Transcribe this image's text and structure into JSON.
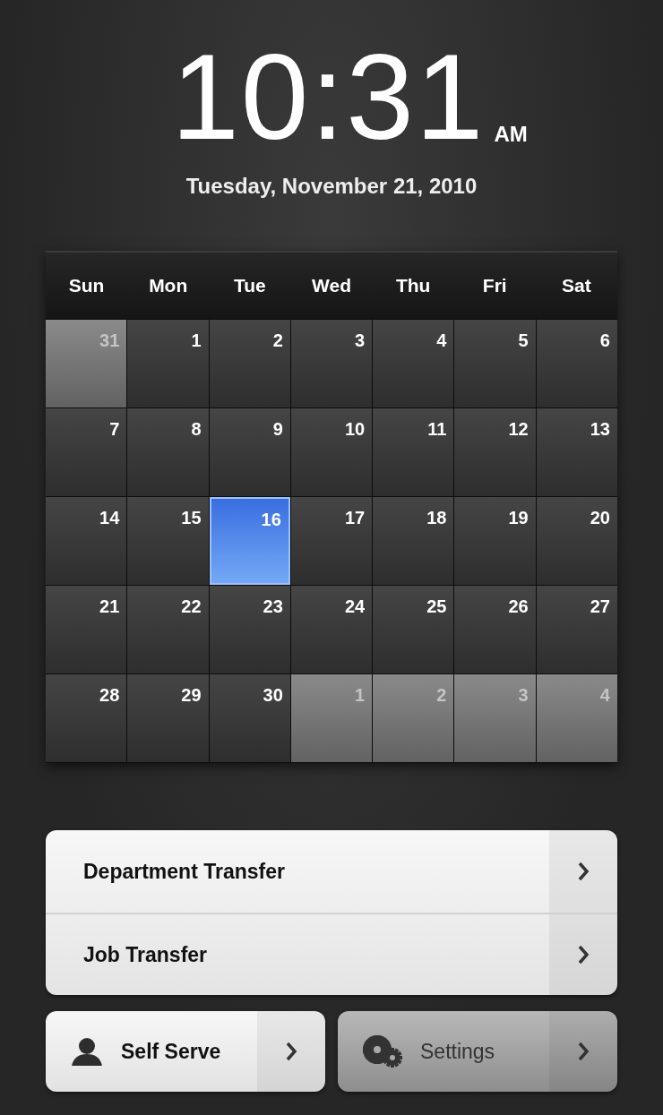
{
  "clock": {
    "time": "10:31",
    "meridiem": "AM",
    "date": "Tuesday, November 21, 2010"
  },
  "calendar": {
    "weekdays": [
      "Sun",
      "Mon",
      "Tue",
      "Wed",
      "Thu",
      "Fri",
      "Sat"
    ],
    "days": [
      {
        "label": "31",
        "muted": true,
        "selected": false
      },
      {
        "label": "1",
        "muted": false,
        "selected": false
      },
      {
        "label": "2",
        "muted": false,
        "selected": false
      },
      {
        "label": "3",
        "muted": false,
        "selected": false
      },
      {
        "label": "4",
        "muted": false,
        "selected": false
      },
      {
        "label": "5",
        "muted": false,
        "selected": false
      },
      {
        "label": "6",
        "muted": false,
        "selected": false
      },
      {
        "label": "7",
        "muted": false,
        "selected": false
      },
      {
        "label": "8",
        "muted": false,
        "selected": false
      },
      {
        "label": "9",
        "muted": false,
        "selected": false
      },
      {
        "label": "10",
        "muted": false,
        "selected": false
      },
      {
        "label": "11",
        "muted": false,
        "selected": false
      },
      {
        "label": "12",
        "muted": false,
        "selected": false
      },
      {
        "label": "13",
        "muted": false,
        "selected": false
      },
      {
        "label": "14",
        "muted": false,
        "selected": false
      },
      {
        "label": "15",
        "muted": false,
        "selected": false
      },
      {
        "label": "16",
        "muted": false,
        "selected": true
      },
      {
        "label": "17",
        "muted": false,
        "selected": false
      },
      {
        "label": "18",
        "muted": false,
        "selected": false
      },
      {
        "label": "19",
        "muted": false,
        "selected": false
      },
      {
        "label": "20",
        "muted": false,
        "selected": false
      },
      {
        "label": "21",
        "muted": false,
        "selected": false
      },
      {
        "label": "22",
        "muted": false,
        "selected": false
      },
      {
        "label": "23",
        "muted": false,
        "selected": false
      },
      {
        "label": "24",
        "muted": false,
        "selected": false
      },
      {
        "label": "25",
        "muted": false,
        "selected": false
      },
      {
        "label": "26",
        "muted": false,
        "selected": false
      },
      {
        "label": "27",
        "muted": false,
        "selected": false
      },
      {
        "label": "28",
        "muted": false,
        "selected": false
      },
      {
        "label": "29",
        "muted": false,
        "selected": false
      },
      {
        "label": "30",
        "muted": false,
        "selected": false
      },
      {
        "label": "1",
        "muted": true,
        "selected": false
      },
      {
        "label": "2",
        "muted": true,
        "selected": false
      },
      {
        "label": "3",
        "muted": true,
        "selected": false
      },
      {
        "label": "4",
        "muted": true,
        "selected": false
      }
    ]
  },
  "menu": [
    {
      "label": "Department Transfer"
    },
    {
      "label": "Job Transfer"
    }
  ],
  "buttons": [
    {
      "label": "Self Serve",
      "kind": "person",
      "pressed": false
    },
    {
      "label": "Settings",
      "kind": "gears",
      "pressed": true
    }
  ]
}
